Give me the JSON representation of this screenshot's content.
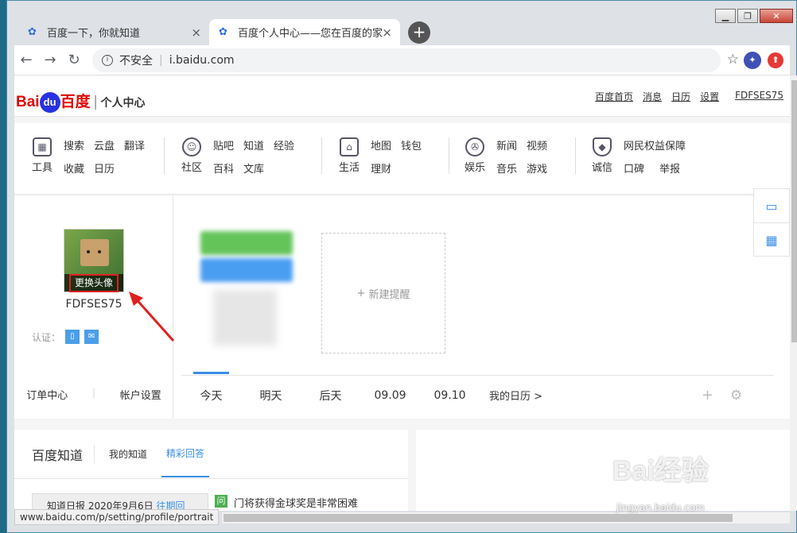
{
  "browser": {
    "tabs": [
      {
        "title": "百度一下，你就知道"
      },
      {
        "title": "百度个人中心——您在百度的家"
      }
    ],
    "new_tab": "+",
    "url_security": "不安全",
    "url": "i.baidu.com",
    "status_url": "www.baidu.com/p/setting/profile/portrait",
    "win_close": "✕",
    "win_min": "▁",
    "win_max": "❐"
  },
  "header": {
    "logo_bai": "Bai",
    "logo_du": "du",
    "logo_baidu": "百度",
    "section": "个人中心",
    "links": [
      "百度首页",
      "消息",
      "日历",
      "设置"
    ],
    "user": "FDFSES75"
  },
  "nav_groups": [
    {
      "icon": "tools-icon",
      "label": "工具",
      "links": [
        "搜索",
        "云盘",
        "翻译",
        "收藏",
        "日历"
      ]
    },
    {
      "icon": "community-icon",
      "label": "社区",
      "links": [
        "贴吧",
        "知道",
        "经验",
        "百科",
        "文库"
      ]
    },
    {
      "icon": "life-icon",
      "label": "生活",
      "links": [
        "地图",
        "钱包",
        "理财"
      ]
    },
    {
      "icon": "entertainment-icon",
      "label": "娱乐",
      "links": [
        "新闻",
        "视频",
        "音乐",
        "游戏"
      ]
    },
    {
      "icon": "shield-icon",
      "label": "诚信",
      "links": [
        "网民权益保障",
        "口碑",
        "举报"
      ]
    }
  ],
  "profile": {
    "change_avatar": "更换头像",
    "username": "FDFSES75",
    "auth_label": "认证：",
    "orders": "订单中心",
    "account_settings": "帐户设置"
  },
  "reminder": {
    "new_reminder": "新建提醒"
  },
  "date_tabs": [
    "今天",
    "明天",
    "后天",
    "09.09",
    "09.10"
  ],
  "my_calendar": "我的日历 >",
  "zhidao": {
    "title": "百度知道",
    "tab_mine": "我的知道",
    "tab_best": "精彩回答",
    "daily_report": "知道日报 2020年9月6日",
    "daily_more": "往期回顾",
    "q_badge": "问",
    "question": "门将获得金球奖是非常困难"
  },
  "watermark": {
    "logo": "Bai经验",
    "url": "jingyan.baidu.com"
  }
}
